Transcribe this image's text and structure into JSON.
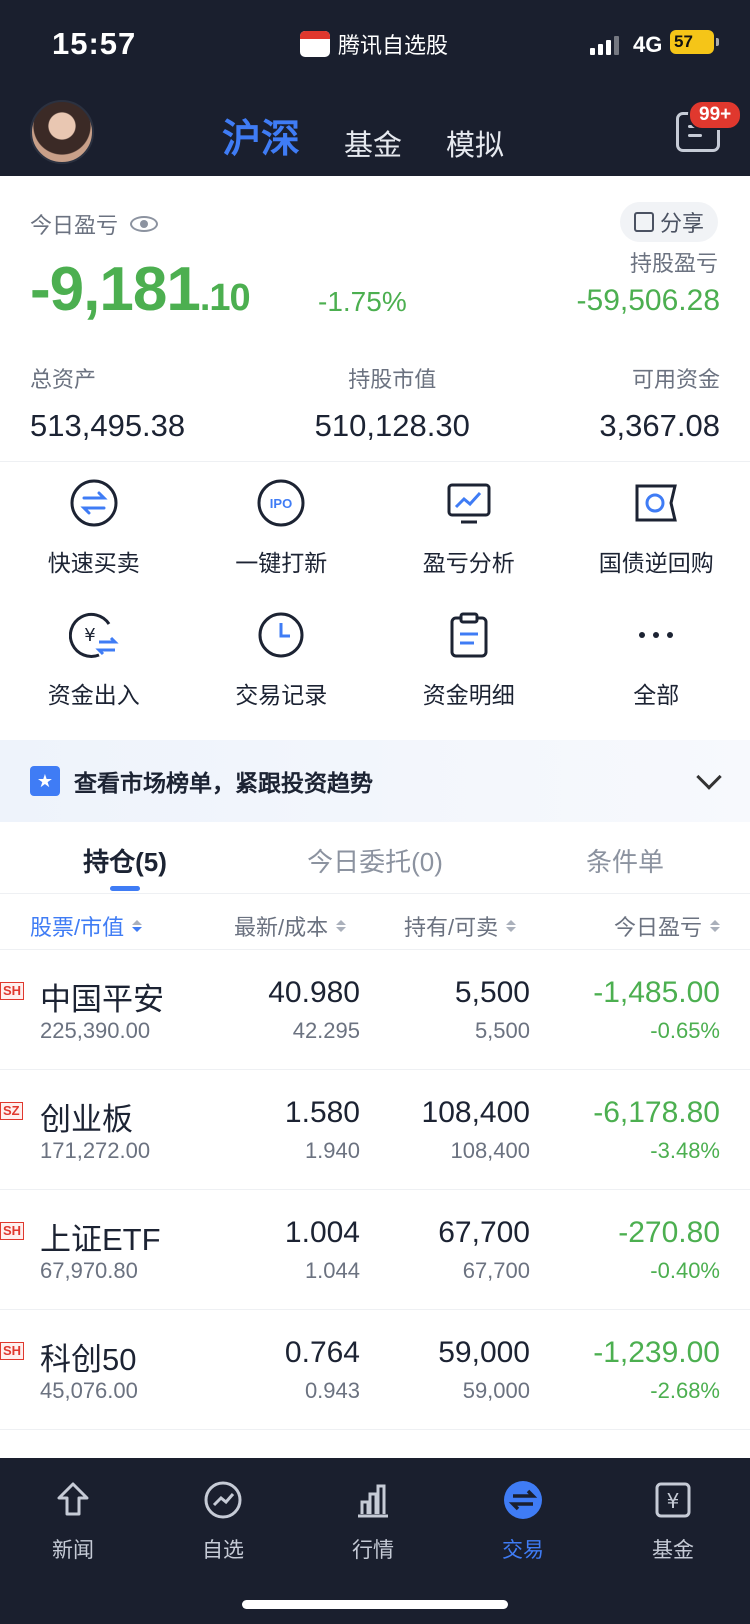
{
  "status": {
    "time": "15:57",
    "app": "腾讯自选股",
    "network": "4G",
    "battery": "57"
  },
  "header": {
    "tabs": [
      {
        "label": "沪深"
      },
      {
        "label": "基金"
      },
      {
        "label": "模拟"
      }
    ],
    "msg_badge": "99+"
  },
  "summary": {
    "today_label": "今日盈亏",
    "share_label": "分享",
    "today_pnl_int": "-9,181",
    "today_pnl_dec": ".10",
    "today_pct": "-1.75%",
    "holding_label": "持股盈亏",
    "holding_pnl": "-59,506.28",
    "total_label": "总资产",
    "total_value": "513,495.38",
    "market_label": "持股市值",
    "market_value": "510,128.30",
    "cash_label": "可用资金",
    "cash_value": "3,367.08"
  },
  "actions": [
    {
      "label": "快速买卖",
      "icon": "swap-icon"
    },
    {
      "label": "一键打新",
      "icon": "ipo-icon"
    },
    {
      "label": "盈亏分析",
      "icon": "monitor-chart-icon"
    },
    {
      "label": "国债逆回购",
      "icon": "ticket-icon"
    },
    {
      "label": "资金出入",
      "icon": "yuan-transfer-icon"
    },
    {
      "label": "交易记录",
      "icon": "clock-icon"
    },
    {
      "label": "资金明细",
      "icon": "clipboard-icon"
    },
    {
      "label": "全部",
      "icon": "more-icon"
    }
  ],
  "banner": {
    "text": "查看市场榜单，紧跟投资趋势"
  },
  "subtabs": [
    {
      "label": "持仓(5)"
    },
    {
      "label": "今日委托(0)"
    },
    {
      "label": "条件单"
    }
  ],
  "columns": [
    "股票/市值",
    "最新/成本",
    "持有/可卖",
    "今日盈亏"
  ],
  "holdings": [
    {
      "market": "SH",
      "name": "中国平安",
      "value": "225,390.00",
      "price": "40.980",
      "cost": "42.295",
      "qty": "5,500",
      "avail": "5,500",
      "pnl": "-1,485.00",
      "pct": "-0.65%"
    },
    {
      "market": "SZ",
      "name": "创业板",
      "value": "171,272.00",
      "price": "1.580",
      "cost": "1.940",
      "qty": "108,400",
      "avail": "108,400",
      "pnl": "-6,178.80",
      "pct": "-3.48%"
    },
    {
      "market": "SH",
      "name": "上证ETF",
      "value": "67,970.80",
      "price": "1.004",
      "cost": "1.044",
      "qty": "67,700",
      "avail": "67,700",
      "pnl": "-270.80",
      "pct": "-0.40%"
    },
    {
      "market": "SH",
      "name": "科创50",
      "value": "45,076.00",
      "price": "0.764",
      "cost": "0.943",
      "qty": "59,000",
      "avail": "59,000",
      "pnl": "-1,239.00",
      "pct": "-2.68%"
    }
  ],
  "bottom_nav": [
    {
      "label": "新闻",
      "icon": "news-icon"
    },
    {
      "label": "自选",
      "icon": "watchlist-icon"
    },
    {
      "label": "行情",
      "icon": "market-icon"
    },
    {
      "label": "交易",
      "icon": "trade-icon"
    },
    {
      "label": "基金",
      "icon": "fund-icon"
    }
  ],
  "colors": {
    "accent": "#3f7cf5",
    "loss": "#4caf50",
    "dark_bg": "#1a1f2e",
    "market_tag": "#e0382e"
  }
}
